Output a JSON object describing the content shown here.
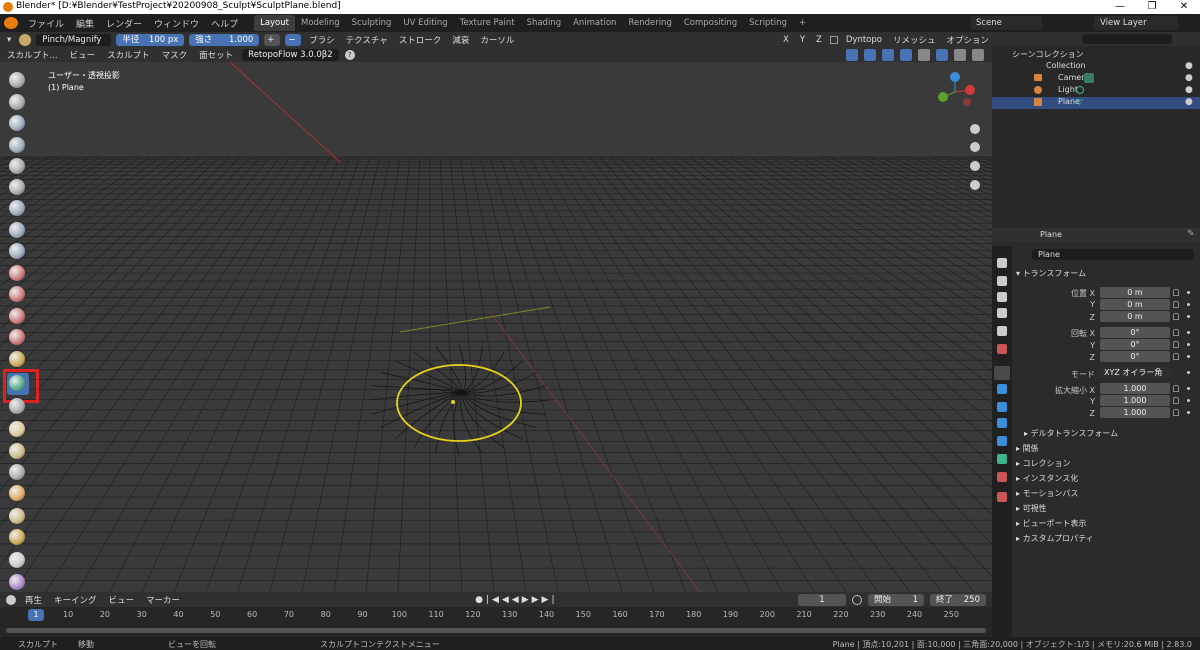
{
  "titlebar": {
    "title": "Blender* [D:¥Blender¥TestProject¥20200908_Sculpt¥SculptPlane.blend]",
    "minimize": "—",
    "maximize": "❐",
    "close": "✕"
  },
  "menu": {
    "items": [
      "ファイル",
      "編集",
      "レンダー",
      "ウィンドウ",
      "ヘルプ"
    ]
  },
  "workspaces": {
    "tabs": [
      "Layout",
      "Modeling",
      "Sculpting",
      "UV Editing",
      "Texture Paint",
      "Shading",
      "Animation",
      "Rendering",
      "Compositing",
      "Scripting"
    ],
    "add": "+"
  },
  "scene": {
    "scene_label": "Scene",
    "view_layer_label": "View Layer"
  },
  "toolheader": {
    "brush_name": "Pinch/Magnify",
    "radius_label": "半径",
    "radius_value": "100 px",
    "strength_label": "強さ",
    "strength_value": "1.000",
    "plus": "+",
    "minus": "−",
    "brush_menu": "ブラシ",
    "texture_menu": "テクスチャ",
    "stroke_menu": "ストローク",
    "falloff_menu": "減衰",
    "cursor_menu": "カーソル",
    "axis_x": "X",
    "axis_y": "Y",
    "axis_z": "Z",
    "dyntopo": "Dyntopo",
    "remesh": "リメッシュ",
    "options": "オプション"
  },
  "modeheader": {
    "mode": "スカルプト...",
    "view": "ビュー",
    "sculpt": "スカルプト",
    "mask": "マスク",
    "faceset": "面セット",
    "addon": "RetopoFlow 3.0.0β2",
    "help": "?"
  },
  "viewport": {
    "view_name": "ユーザー・透視投影",
    "object": "(1) Plane",
    "axis_x": "X",
    "axis_y": "Y",
    "axis_z": "Z"
  },
  "timeline_header": {
    "playback": "再生",
    "keying": "キーイング",
    "view": "ビュー",
    "marker": "マーカー",
    "current_frame": "1",
    "start_label": "開始",
    "start": "1",
    "end_label": "終了",
    "end": "250"
  },
  "timeline": {
    "ticks": [
      "1",
      "10",
      "20",
      "30",
      "40",
      "50",
      "60",
      "70",
      "80",
      "90",
      "100",
      "110",
      "120",
      "130",
      "140",
      "150",
      "160",
      "170",
      "180",
      "190",
      "200",
      "210",
      "220",
      "230",
      "240",
      "250"
    ]
  },
  "statusbar": {
    "left1": "スカルプト",
    "left2": "移動",
    "left3": "ビューを回転",
    "left4": "スカルプトコンテクストメニュー",
    "right": "Plane | 頂点:10,201 | 面:10,000 | 三角面:20,000 | オブジェクト:1/3 | メモリ:20.6 MiB | 2.83.0"
  },
  "outliner": {
    "root": "シーンコレクション",
    "collection": "Collection",
    "items": [
      "Camera",
      "Light",
      "Plane"
    ]
  },
  "properties": {
    "header_object": "Plane",
    "object_name": "Plane",
    "transform_panel": "トランスフォーム",
    "location_label": "位置 X",
    "loc": [
      "0 m",
      "0 m",
      "0 m"
    ],
    "rotation_label": "回転 X",
    "rot": [
      "0°",
      "0°",
      "0°"
    ],
    "mode_label": "モード",
    "mode_value": "XYZ オイラー角",
    "scale_label": "拡大縮小 X",
    "scale": [
      "1.000",
      "1.000",
      "1.000"
    ],
    "y": "Y",
    "z": "Z",
    "delta": "デルタトランスフォーム",
    "panels": [
      "関係",
      "コレクション",
      "インスタンス化",
      "モーションパス",
      "可視性",
      "ビューポート表示",
      "カスタムプロパティ"
    ]
  }
}
